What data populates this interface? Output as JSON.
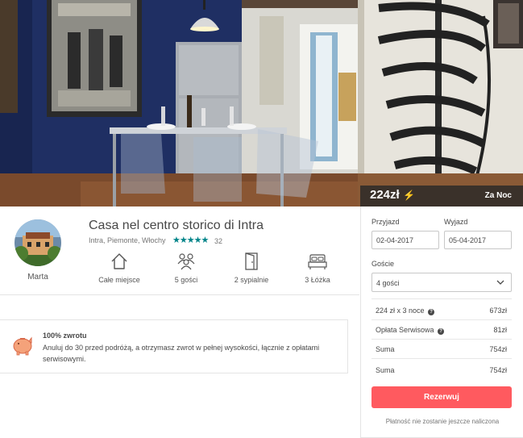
{
  "price_bar": {
    "price": "224zł",
    "per": "Za Noc"
  },
  "host": {
    "name": "Marta"
  },
  "listing": {
    "title": "Casa nel centro storico di Intra",
    "location": "Intra, Piemonte, Włochy",
    "rating": 4.5,
    "stars": "★★★★★",
    "reviews": "32"
  },
  "amenities": [
    {
      "icon": "home-icon",
      "label": "Całe miejsce"
    },
    {
      "icon": "guests-icon",
      "label": "5 gości"
    },
    {
      "icon": "door-icon",
      "label": "2 sypialnie"
    },
    {
      "icon": "bed-icon",
      "label": "3 Łóżka"
    }
  ],
  "refund": {
    "title": "100% zwrotu",
    "text": "Anuluj do 30 przed podróżą, a otrzymasz zwrot w pełnej wysokości, łącznie z opłatami serwisowymi."
  },
  "booking": {
    "checkin_label": "Przyjazd",
    "checkout_label": "Wyjazd",
    "checkin": "02-04-2017",
    "checkout": "05-04-2017",
    "guests_label": "Goście",
    "guests": "4 gości",
    "nights_label": "224 zł x 3 noce",
    "nights_value": "673zł",
    "fee_label": "Opłata Serwisowa",
    "fee_value": "81zł",
    "sum1_label": "Suma",
    "sum1_value": "754zł",
    "sum2_label": "Suma",
    "sum2_value": "754zł",
    "reserve": "Rezerwuj",
    "note": "Płatność nie zostanie jeszcze naliczona"
  },
  "colors": {
    "accent": "#ff5a5f",
    "teal": "#008489",
    "text": "#484848"
  }
}
